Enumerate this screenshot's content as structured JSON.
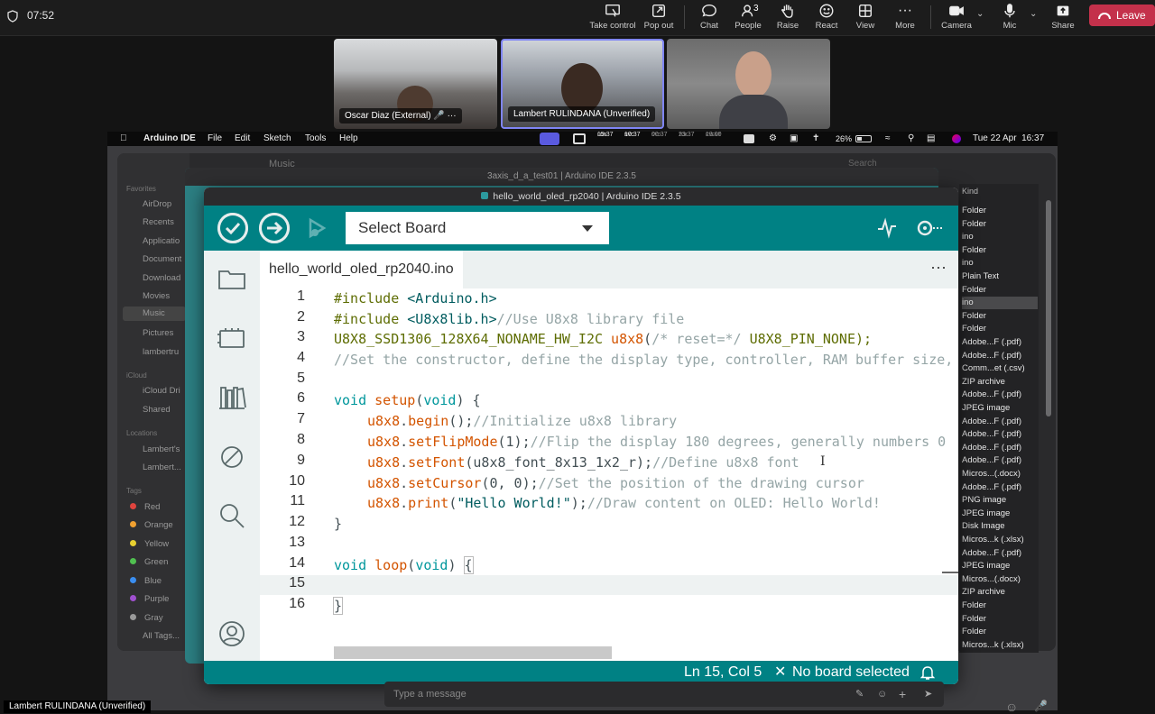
{
  "meeting": {
    "timer": "07:52",
    "buttons": [
      {
        "label": "Take control",
        "icon": "take-control-icon"
      },
      {
        "label": "Pop out",
        "icon": "pop-out-icon"
      },
      {
        "label": "Chat",
        "icon": "chat-icon"
      },
      {
        "label": "People",
        "icon": "people-icon",
        "count": "3"
      },
      {
        "label": "Raise",
        "icon": "raise-hand-icon"
      },
      {
        "label": "React",
        "icon": "react-icon"
      },
      {
        "label": "View",
        "icon": "view-icon"
      },
      {
        "label": "More",
        "icon": "more-icon"
      },
      {
        "label": "Camera",
        "icon": "camera-icon"
      },
      {
        "label": "Mic",
        "icon": "mic-icon"
      },
      {
        "label": "Share",
        "icon": "share-icon"
      }
    ],
    "leave_label": "Leave",
    "participants": [
      "Oscar Diaz (External)",
      "Lambert RULINDANA (Unverified)"
    ],
    "bottom_name": "Lambert RULINDANA (Unverified)",
    "message_placeholder": "Type a message",
    "colors": {
      "leave": "#c4314b",
      "bar": "#1c1c1c"
    }
  },
  "macos": {
    "app_name": "Arduino IDE",
    "menus": [
      "File",
      "Edit",
      "Sketch",
      "Tools",
      "Help"
    ],
    "clocks": [
      {
        "city": "LON",
        "time": "15:37"
      },
      {
        "city": "NYC",
        "time": "10:37"
      },
      {
        "city": "SYD",
        "time": "00:37"
      },
      {
        "city": "TOK",
        "time": "23:37"
      },
      {
        "city": "EVENT",
        "time": "19:00"
      }
    ],
    "battery": "26%",
    "datetime": "Tue 22 Apr  16:37"
  },
  "finder": {
    "title": "Music",
    "search_placeholder": "Search",
    "favorites_header": "Favorites",
    "favorites": [
      "AirDrop",
      "Recents",
      "Applicatio",
      "Document",
      "Download",
      "Movies",
      "Music",
      "Pictures",
      "lambertru"
    ],
    "icloud_header": "iCloud",
    "icloud": [
      "iCloud Dri",
      "Shared"
    ],
    "locations_header": "Locations",
    "locations": [
      "Lambert's",
      "Lambert..."
    ],
    "tags_header": "Tags",
    "tags": [
      {
        "name": "Red",
        "color": "#e0443e"
      },
      {
        "name": "Orange",
        "color": "#f0a030"
      },
      {
        "name": "Yellow",
        "color": "#e8d030"
      },
      {
        "name": "Green",
        "color": "#50c050"
      },
      {
        "name": "Blue",
        "color": "#3a8ef0"
      },
      {
        "name": "Purple",
        "color": "#a050d0"
      },
      {
        "name": "Gray",
        "color": "#9a9a9a"
      },
      {
        "name": "All Tags...",
        "color": ""
      }
    ],
    "kind_header": "Kind",
    "kinds": [
      "Folder",
      "Folder",
      "ino",
      "Folder",
      "ino",
      "Plain Text",
      "Folder",
      "ino",
      "Folder",
      "Folder",
      "Adobe...F (.pdf)",
      "Adobe...F (.pdf)",
      "Comm...et (.csv)",
      "ZIP archive",
      "Adobe...F (.pdf)",
      "JPEG image",
      "Adobe...F (.pdf)",
      "Adobe...F (.pdf)",
      "Adobe...F (.pdf)",
      "Adobe...F (.pdf)",
      "Micros...(.docx)",
      "Adobe...F (.pdf)",
      "PNG image",
      "JPEG image",
      "Disk Image",
      "Micros...k (.xlsx)",
      "Adobe...F (.pdf)",
      "JPEG image",
      "Micros...(.docx)",
      "ZIP archive",
      "Folder",
      "Folder",
      "Folder",
      "Micros...k (.xlsx)"
    ]
  },
  "background_window": {
    "title": "3axis_d_a_test01 | Arduino IDE 2.3.5"
  },
  "arduino": {
    "window_title": "hello_world_oled_rp2040 | Arduino IDE 2.3.5",
    "board_select": "Select Board",
    "tab_name": "hello_world_oled_rp2040.ino",
    "tab_menu": "···",
    "code_lines": [
      "1",
      "2",
      "3",
      "4",
      "5",
      "6",
      "7",
      "8",
      "9",
      "10",
      "11",
      "12",
      "13",
      "14",
      "15",
      "16"
    ],
    "code": {
      "l1a": "#include ",
      "l1b": "<Arduino.h>",
      "l2a": "#include ",
      "l2b": "<U8x8lib.h>",
      "l2c": "//Use U8x8 library file",
      "l3a": "U8X8_SSD1306_128X64_NONAME_HW_I2C ",
      "l3b": "u8x8",
      "l3c": "(",
      "l3d": "/* reset=*/",
      "l3e": " U8X8_PIN_NONE);",
      "l4": "//Set the constructor, define the display type, controller, RAM buffer size,",
      "l6a": "void ",
      "l6b": "setup",
      "l6c": "(",
      "l6d": "void",
      "l6e": ") {",
      "l7a": "u8x8",
      "l7b": ".",
      "l7c": "begin",
      "l7d": "();",
      "l7e": "//Initialize u8x8 library",
      "l8a": "u8x8",
      "l8b": ".",
      "l8c": "setFlipMode",
      "l8d": "(1);",
      "l8e": "//Flip the display 180 degrees, generally numbers 0",
      "l9a": "u8x8",
      "l9b": ".",
      "l9c": "setFont",
      "l9d": "(u8x8_font_8x13_1x2_r);",
      "l9e": "//Define u8x8 font",
      "l10a": "u8x8",
      "l10b": ".",
      "l10c": "setCursor",
      "l10d": "(0, 0);",
      "l10e": "//Set the position of the drawing cursor",
      "l11a": "u8x8",
      "l11b": ".",
      "l11c": "print",
      "l11d": "(",
      "l11e": "\"Hello World!\"",
      "l11f": ");",
      "l11g": "//Draw content on OLED: Hello World!",
      "l12": "}",
      "l14a": "void ",
      "l14b": "loop",
      "l14c": "(",
      "l14d": "void",
      "l14e": ") ",
      "l14f": "{",
      "l16": "}"
    },
    "status_position": "Ln 15, Col 5",
    "status_board": "No board selected",
    "colors": {
      "teal": "#008184",
      "keyword": "#00979c",
      "function": "#d35400",
      "comment": "#95a5a6",
      "preprocessor": "#5e6d03"
    }
  }
}
